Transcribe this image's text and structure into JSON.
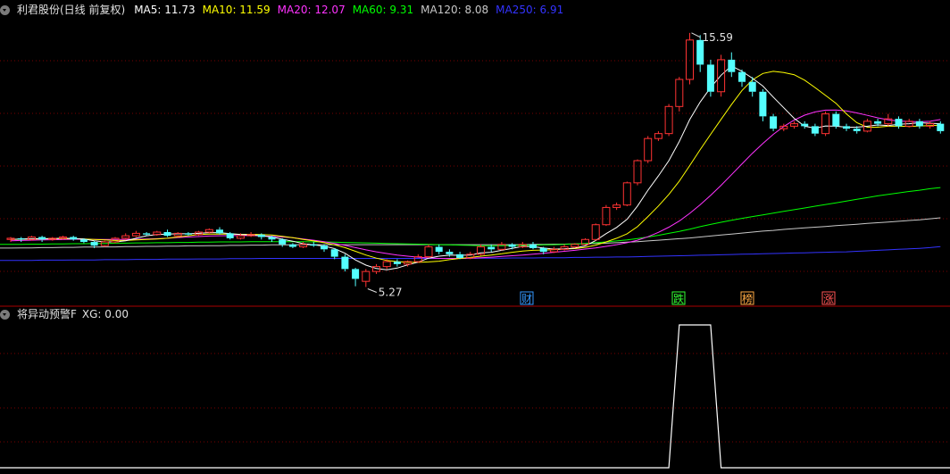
{
  "main_panel": {
    "title": "利君股份(日线 前复权)",
    "ma_legend": [
      {
        "label": "MA5: 11.73",
        "color": "#ffffff"
      },
      {
        "label": "MA10: 11.59",
        "color": "#ffff00"
      },
      {
        "label": "MA20: 12.07",
        "color": "#ff33ff"
      },
      {
        "label": "MA60: 9.31",
        "color": "#00ff00"
      },
      {
        "label": "MA120: 8.08",
        "color": "#c8c8c8"
      },
      {
        "label": "MA250: 6.91",
        "color": "#3333ff"
      }
    ],
    "annotations": {
      "high": "15.59",
      "low": "5.27"
    },
    "markers": [
      {
        "text": "财",
        "color": "#3399ff",
        "border": "#3399ff"
      },
      {
        "text": "跌",
        "color": "#33ff33",
        "border": "#33ff33"
      },
      {
        "text": "榜",
        "color": "#ffaa44",
        "border": "#ffaa44"
      },
      {
        "text": "涨",
        "color": "#ff5555",
        "border": "#ff5555"
      }
    ]
  },
  "sub_panel": {
    "title": "将异动预警F",
    "value_label": "XG: 0.00"
  },
  "colors": {
    "up": "#ff3333",
    "down": "#54ffff",
    "grid": "#7a0000",
    "separator": "#aa0000",
    "xg_line": "#ffffff"
  },
  "chart_data": {
    "type": "candlestick",
    "low_value": 5.27,
    "high_value": 15.59,
    "candles": [
      [
        7.2,
        7.25,
        7.1,
        7.3
      ],
      [
        7.25,
        7.2,
        7.1,
        7.3
      ],
      [
        7.2,
        7.3,
        7.15,
        7.35
      ],
      [
        7.3,
        7.2,
        7.1,
        7.35
      ],
      [
        7.2,
        7.25,
        7.15,
        7.3
      ],
      [
        7.25,
        7.3,
        7.2,
        7.35
      ],
      [
        7.3,
        7.2,
        7.15,
        7.35
      ],
      [
        7.2,
        7.1,
        7.05,
        7.25
      ],
      [
        7.1,
        6.95,
        6.85,
        7.15
      ],
      [
        6.95,
        7.1,
        6.9,
        7.15
      ],
      [
        7.1,
        7.25,
        7.05,
        7.3
      ],
      [
        7.25,
        7.35,
        7.2,
        7.45
      ],
      [
        7.35,
        7.45,
        7.3,
        7.55
      ],
      [
        7.45,
        7.4,
        7.35,
        7.5
      ],
      [
        7.4,
        7.5,
        7.35,
        7.55
      ],
      [
        7.5,
        7.35,
        7.3,
        7.6
      ],
      [
        7.35,
        7.45,
        7.3,
        7.5
      ],
      [
        7.45,
        7.4,
        7.35,
        7.5
      ],
      [
        7.4,
        7.5,
        7.35,
        7.55
      ],
      [
        7.5,
        7.6,
        7.45,
        7.65
      ],
      [
        7.6,
        7.45,
        7.4,
        7.7
      ],
      [
        7.45,
        7.25,
        7.2,
        7.5
      ],
      [
        7.25,
        7.35,
        7.2,
        7.45
      ],
      [
        7.35,
        7.4,
        7.3,
        7.5
      ],
      [
        7.4,
        7.3,
        7.2,
        7.45
      ],
      [
        7.3,
        7.2,
        7.1,
        7.35
      ],
      [
        7.2,
        7.0,
        6.9,
        7.25
      ],
      [
        7.0,
        6.9,
        6.85,
        7.05
      ],
      [
        6.9,
        7.0,
        6.85,
        7.1
      ],
      [
        7.0,
        6.95,
        6.9,
        7.1
      ],
      [
        6.95,
        6.8,
        6.7,
        7.0
      ],
      [
        6.8,
        6.5,
        6.4,
        6.85
      ],
      [
        6.5,
        6.0,
        5.9,
        6.6
      ],
      [
        6.0,
        5.6,
        5.3,
        6.05
      ],
      [
        5.5,
        5.9,
        5.27,
        6.0
      ],
      [
        5.9,
        6.1,
        5.8,
        6.2
      ],
      [
        6.1,
        6.3,
        6.0,
        6.4
      ],
      [
        6.3,
        6.2,
        6.1,
        6.4
      ],
      [
        6.2,
        6.3,
        6.1,
        6.35
      ],
      [
        6.3,
        6.5,
        6.25,
        6.6
      ],
      [
        6.5,
        6.9,
        6.45,
        7.0
      ],
      [
        6.9,
        6.7,
        6.6,
        7.0
      ],
      [
        6.7,
        6.6,
        6.5,
        6.8
      ],
      [
        6.6,
        6.45,
        6.4,
        6.7
      ],
      [
        6.45,
        6.6,
        6.4,
        6.7
      ],
      [
        6.6,
        6.9,
        6.55,
        7.0
      ],
      [
        6.9,
        6.8,
        6.7,
        7.0
      ],
      [
        6.8,
        7.0,
        6.75,
        7.1
      ],
      [
        7.0,
        6.9,
        6.8,
        7.05
      ],
      [
        6.9,
        7.0,
        6.85,
        7.1
      ],
      [
        7.0,
        6.85,
        6.8,
        7.1
      ],
      [
        6.85,
        6.7,
        6.6,
        6.9
      ],
      [
        6.7,
        6.8,
        6.65,
        6.9
      ],
      [
        6.8,
        6.9,
        6.75,
        7.0
      ],
      [
        6.9,
        7.0,
        6.85,
        7.05
      ],
      [
        7.0,
        7.2,
        6.95,
        7.25
      ],
      [
        7.2,
        7.8,
        7.15,
        7.85
      ],
      [
        7.8,
        8.5,
        7.75,
        8.6
      ],
      [
        8.5,
        8.6,
        8.4,
        8.7
      ],
      [
        8.6,
        9.5,
        8.55,
        9.55
      ],
      [
        9.5,
        10.4,
        9.4,
        10.45
      ],
      [
        10.4,
        11.3,
        10.3,
        11.4
      ],
      [
        11.3,
        11.5,
        11.2,
        11.6
      ],
      [
        11.5,
        12.6,
        11.4,
        12.7
      ],
      [
        12.6,
        13.7,
        12.4,
        13.8
      ],
      [
        13.7,
        15.3,
        13.5,
        15.59
      ],
      [
        15.3,
        14.3,
        14.0,
        15.5
      ],
      [
        14.3,
        13.2,
        13.0,
        14.5
      ],
      [
        13.2,
        14.5,
        13.0,
        14.7
      ],
      [
        14.5,
        14.0,
        13.8,
        14.8
      ],
      [
        14.0,
        13.6,
        13.4,
        14.1
      ],
      [
        13.6,
        13.2,
        13.0,
        13.8
      ],
      [
        13.2,
        12.2,
        12.0,
        13.3
      ],
      [
        12.2,
        11.7,
        11.6,
        12.3
      ],
      [
        11.7,
        11.8,
        11.6,
        11.9
      ],
      [
        11.8,
        11.9,
        11.7,
        12.0
      ],
      [
        11.9,
        11.8,
        11.7,
        12.0
      ],
      [
        11.8,
        11.5,
        11.4,
        11.9
      ],
      [
        11.5,
        12.3,
        11.4,
        12.4
      ],
      [
        12.3,
        11.8,
        11.7,
        12.4
      ],
      [
        11.8,
        11.7,
        11.6,
        11.9
      ],
      [
        11.7,
        11.6,
        11.5,
        11.8
      ],
      [
        11.6,
        12.0,
        11.55,
        12.1
      ],
      [
        12.0,
        11.9,
        11.8,
        12.1
      ],
      [
        11.9,
        12.1,
        11.8,
        12.3
      ],
      [
        12.1,
        11.8,
        11.7,
        12.2
      ],
      [
        11.8,
        12.0,
        11.75,
        12.1
      ],
      [
        12.0,
        11.8,
        11.7,
        12.1
      ],
      [
        11.8,
        11.9,
        11.7,
        12.0
      ],
      [
        11.9,
        11.6,
        11.5,
        12.0
      ]
    ],
    "ma": {
      "MA5": [
        7.2,
        7.22,
        7.23,
        7.23,
        7.24,
        7.25,
        7.24,
        7.22,
        7.15,
        7.1,
        7.1,
        7.15,
        7.25,
        7.35,
        7.4,
        7.42,
        7.43,
        7.43,
        7.45,
        7.48,
        7.48,
        7.44,
        7.4,
        7.38,
        7.35,
        7.3,
        7.21,
        7.13,
        7.03,
        6.98,
        6.93,
        6.83,
        6.64,
        6.37,
        6.16,
        6.02,
        5.97,
        6.04,
        6.17,
        6.28,
        6.44,
        6.52,
        6.56,
        6.56,
        6.57,
        6.66,
        6.68,
        6.76,
        6.84,
        6.92,
        6.91,
        6.85,
        6.81,
        6.82,
        6.85,
        6.94,
        7.16,
        7.44,
        7.69,
        8.02,
        8.56,
        9.2,
        9.78,
        10.4,
        11.18,
        12.07,
        12.78,
        13.37,
        13.87,
        14.25,
        14.03,
        13.75,
        13.43,
        12.98,
        12.55,
        12.12,
        11.8,
        11.72,
        11.81,
        11.8,
        11.76,
        11.76,
        11.8,
        11.85,
        11.83,
        11.88,
        11.9,
        11.94,
        11.92,
        11.9
      ],
      "MA10": [
        7.2,
        7.21,
        7.22,
        7.22,
        7.23,
        7.23,
        7.23,
        7.22,
        7.2,
        7.18,
        7.16,
        7.16,
        7.18,
        7.2,
        7.22,
        7.25,
        7.3,
        7.35,
        7.4,
        7.42,
        7.42,
        7.42,
        7.41,
        7.41,
        7.4,
        7.38,
        7.33,
        7.27,
        7.2,
        7.14,
        7.07,
        6.98,
        6.87,
        6.72,
        6.57,
        6.44,
        6.35,
        6.3,
        6.28,
        6.27,
        6.29,
        6.32,
        6.38,
        6.43,
        6.47,
        6.52,
        6.57,
        6.62,
        6.68,
        6.73,
        6.76,
        6.77,
        6.79,
        6.81,
        6.83,
        6.88,
        6.97,
        7.1,
        7.25,
        7.43,
        7.72,
        8.13,
        8.56,
        9.03,
        9.57,
        10.2,
        10.85,
        11.47,
        12.08,
        12.68,
        13.25,
        13.68,
        13.94,
        14.03,
        13.98,
        13.89,
        13.67,
        13.37,
        13.05,
        12.73,
        12.3,
        11.94,
        11.76,
        11.76,
        11.8,
        11.8,
        11.79,
        11.81,
        11.82,
        11.84
      ],
      "MA20": [
        7.15,
        7.16,
        7.17,
        7.18,
        7.19,
        7.2,
        7.21,
        7.21,
        7.2,
        7.2,
        7.2,
        7.2,
        7.21,
        7.22,
        7.23,
        7.25,
        7.28,
        7.3,
        7.32,
        7.34,
        7.35,
        7.36,
        7.36,
        7.36,
        7.35,
        7.33,
        7.3,
        7.27,
        7.22,
        7.17,
        7.11,
        7.04,
        6.96,
        6.87,
        6.78,
        6.7,
        6.63,
        6.57,
        6.52,
        6.48,
        6.45,
        6.43,
        6.43,
        6.43,
        6.44,
        6.46,
        6.48,
        6.51,
        6.54,
        6.57,
        6.6,
        6.64,
        6.68,
        6.72,
        6.76,
        6.81,
        6.86,
        6.92,
        6.99,
        7.07,
        7.17,
        7.31,
        7.49,
        7.7,
        7.95,
        8.26,
        8.61,
        8.99,
        9.4,
        9.83,
        10.27,
        10.7,
        11.1,
        11.47,
        11.79,
        12.05,
        12.25,
        12.38,
        12.45,
        12.46,
        12.42,
        12.34,
        12.24,
        12.14,
        12.06,
        12.01,
        11.99,
        11.98,
        12.0,
        12.07
      ],
      "MA60": [
        7.0,
        7.0,
        7.01,
        7.01,
        7.02,
        7.02,
        7.03,
        7.03,
        7.04,
        7.04,
        7.05,
        7.05,
        7.06,
        7.06,
        7.07,
        7.07,
        7.08,
        7.08,
        7.09,
        7.09,
        7.1,
        7.1,
        7.1,
        7.11,
        7.11,
        7.11,
        7.11,
        7.11,
        7.11,
        7.1,
        7.1,
        7.09,
        7.08,
        7.07,
        7.06,
        7.05,
        7.04,
        7.03,
        7.02,
        7.01,
        7.0,
        6.99,
        6.98,
        6.97,
        6.96,
        6.95,
        6.95,
        6.95,
        6.96,
        6.96,
        6.97,
        6.98,
        6.99,
        7.0,
        7.02,
        7.04,
        7.07,
        7.1,
        7.14,
        7.18,
        7.24,
        7.3,
        7.37,
        7.45,
        7.53,
        7.62,
        7.72,
        7.81,
        7.9,
        7.98,
        8.06,
        8.13,
        8.2,
        8.27,
        8.34,
        8.41,
        8.48,
        8.55,
        8.62,
        8.69,
        8.76,
        8.83,
        8.9,
        8.97,
        9.03,
        9.09,
        9.15,
        9.2,
        9.26,
        9.31
      ],
      "MA120": [
        6.85,
        6.86,
        6.86,
        6.87,
        6.87,
        6.88,
        6.88,
        6.89,
        6.89,
        6.9,
        6.9,
        6.91,
        6.91,
        6.92,
        6.92,
        6.93,
        6.93,
        6.94,
        6.94,
        6.95,
        6.95,
        6.96,
        6.96,
        6.97,
        6.97,
        6.98,
        6.98,
        6.98,
        6.99,
        6.99,
        6.99,
        6.99,
        6.99,
        6.99,
        6.99,
        6.99,
        6.99,
        6.99,
        6.99,
        6.99,
        6.99,
        6.99,
        6.99,
        6.99,
        6.99,
        6.99,
        6.99,
        6.99,
        6.99,
        6.99,
        7.0,
        7.0,
        7.01,
        7.01,
        7.02,
        7.03,
        7.04,
        7.05,
        7.07,
        7.09,
        7.11,
        7.14,
        7.17,
        7.2,
        7.23,
        7.26,
        7.3,
        7.34,
        7.38,
        7.42,
        7.46,
        7.5,
        7.54,
        7.57,
        7.61,
        7.64,
        7.67,
        7.7,
        7.73,
        7.76,
        7.79,
        7.82,
        7.85,
        7.88,
        7.91,
        7.94,
        7.97,
        8.0,
        8.04,
        8.08
      ],
      "MA250": [
        6.35,
        6.35,
        6.35,
        6.36,
        6.36,
        6.36,
        6.37,
        6.37,
        6.37,
        6.38,
        6.38,
        6.38,
        6.39,
        6.39,
        6.39,
        6.4,
        6.4,
        6.4,
        6.41,
        6.41,
        6.41,
        6.42,
        6.42,
        6.42,
        6.43,
        6.43,
        6.43,
        6.43,
        6.43,
        6.43,
        6.43,
        6.43,
        6.43,
        6.43,
        6.43,
        6.43,
        6.43,
        6.43,
        6.43,
        6.43,
        6.43,
        6.43,
        6.43,
        6.43,
        6.43,
        6.44,
        6.44,
        6.44,
        6.45,
        6.45,
        6.45,
        6.46,
        6.46,
        6.46,
        6.47,
        6.47,
        6.48,
        6.48,
        6.49,
        6.49,
        6.5,
        6.51,
        6.52,
        6.53,
        6.54,
        6.55,
        6.56,
        6.57,
        6.58,
        6.59,
        6.6,
        6.61,
        6.62,
        6.63,
        6.64,
        6.65,
        6.66,
        6.67,
        6.68,
        6.69,
        6.7,
        6.72,
        6.74,
        6.76,
        6.78,
        6.8,
        6.82,
        6.84,
        6.87,
        6.91
      ]
    },
    "xg": [
      0,
      0,
      0,
      0,
      0,
      0,
      0,
      0,
      0,
      0,
      0,
      0,
      0,
      0,
      0,
      0,
      0,
      0,
      0,
      0,
      0,
      0,
      0,
      0,
      0,
      0,
      0,
      0,
      0,
      0,
      0,
      0,
      0,
      0,
      0,
      0,
      0,
      0,
      0,
      0,
      0,
      0,
      0,
      0,
      0,
      0,
      0,
      0,
      0,
      0,
      0,
      0,
      0,
      0,
      0,
      0,
      0,
      0,
      0,
      0,
      0,
      0,
      0,
      0,
      1,
      1,
      1,
      1,
      0,
      0,
      0,
      0,
      0,
      0,
      0,
      0,
      0,
      0,
      0,
      0,
      0,
      0,
      0,
      0,
      0,
      0,
      0,
      0,
      0,
      0
    ]
  }
}
